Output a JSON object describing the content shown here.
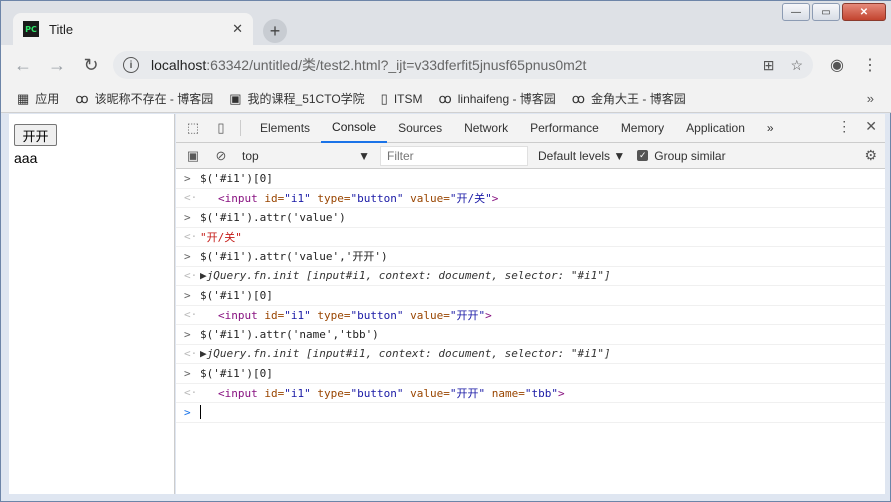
{
  "tab": {
    "favicon_label": "PC",
    "title": "Title",
    "close_glyph": "✕",
    "new_tab_glyph": "+"
  },
  "window_buttons": {
    "minimize": "—",
    "maximize": "▭",
    "close": "✕"
  },
  "toolbar": {
    "back_glyph": "←",
    "forward_glyph": "→",
    "reload_glyph": "↻",
    "url_host": "localhost",
    "url_rest": ":63342/untitled/类/test2.html?_ijt=v33dferfit5jnusf65pnus0m2t",
    "translate_glyph": "⊞",
    "star_glyph": "☆",
    "account_glyph": "◉",
    "menu_glyph": "⋮"
  },
  "bookmarks": [
    {
      "icon": "▦",
      "label": "应用"
    },
    {
      "icon": "ꝏ",
      "label": "该昵称不存在 - 博客园"
    },
    {
      "icon": "▣",
      "label": "我的课程_51CTO学院"
    },
    {
      "icon": "▯",
      "label": "ITSM"
    },
    {
      "icon": "ꝏ",
      "label": "linhaifeng - 博客园"
    },
    {
      "icon": "ꝏ",
      "label": "金角大王 - 博客园"
    }
  ],
  "bookmarks_more": "»",
  "page": {
    "button_value": "开开",
    "text": "aaa"
  },
  "devtools": {
    "tabs": [
      "Elements",
      "Console",
      "Sources",
      "Network",
      "Performance",
      "Memory",
      "Application"
    ],
    "active_tab": "Console",
    "more_glyph": "»",
    "menu_glyph": "⋮",
    "close_glyph": "✕",
    "context": "top",
    "filter_placeholder": "Filter",
    "levels_label": "Default levels ▼",
    "group_similar_label": "Group similar",
    "settings_glyph": "⚙"
  },
  "console": [
    {
      "kind": "in",
      "text": "$('#i1')[0]"
    },
    {
      "kind": "out-el",
      "value": "开/关",
      "name": ""
    },
    {
      "kind": "in",
      "text": "$('#i1').attr('value')"
    },
    {
      "kind": "out-str",
      "text": "\"开/关\""
    },
    {
      "kind": "in",
      "text": "$('#i1').attr('value','开开')"
    },
    {
      "kind": "out-obj",
      "text": "jQuery.fn.init [input#i1, context: document, selector: \"#i1\"]"
    },
    {
      "kind": "in",
      "text": "$('#i1')[0]"
    },
    {
      "kind": "out-el",
      "value": "开开",
      "name": ""
    },
    {
      "kind": "in",
      "text": "$('#i1').attr('name','tbb')"
    },
    {
      "kind": "out-obj",
      "text": "jQuery.fn.init [input#i1, context: document, selector: \"#i1\"]"
    },
    {
      "kind": "in",
      "text": "$('#i1')[0]"
    },
    {
      "kind": "out-el",
      "value": "开开",
      "name": "tbb"
    }
  ]
}
